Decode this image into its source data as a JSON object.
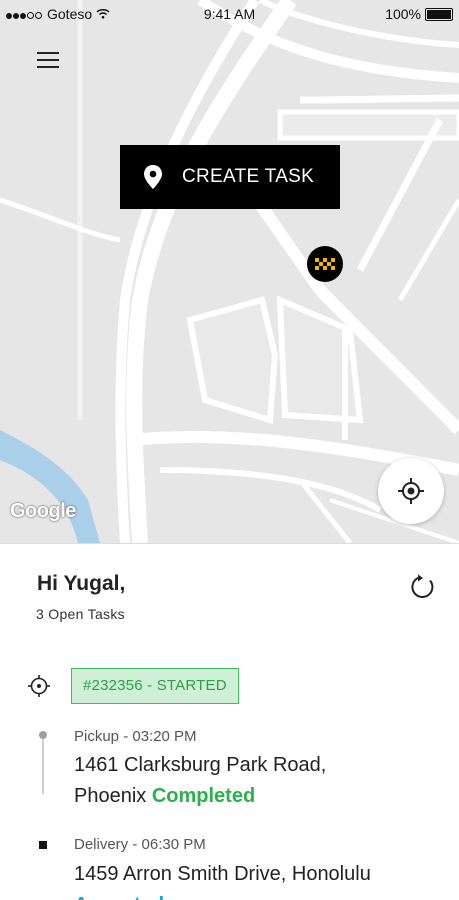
{
  "status_bar": {
    "carrier": "Goteso",
    "time": "9:41 AM",
    "battery": "100%"
  },
  "map": {
    "create_task_label": "CREATE TASK",
    "google_label": "Google"
  },
  "sheet": {
    "greeting": "Hi Yugal,",
    "open_tasks": "3 Open Tasks",
    "task": {
      "badge": "#232356 - STARTED",
      "pickup": {
        "time": "Pickup - 03:20 PM",
        "address_line1": "1461 Clarksburg Park Road,",
        "address_line2": "Phoenix",
        "status": "Completed"
      },
      "delivery": {
        "time": "Delivery - 06:30 PM",
        "address": "1459  Arron Smith Drive, Honolulu",
        "status": "Accepted"
      }
    }
  },
  "colors": {
    "completed": "#2bb14b",
    "accepted": "#1ba3d6",
    "badge_bg": "#cff0d6",
    "badge_text": "#2aa047"
  },
  "icons": [
    "menu-icon",
    "map-pin-icon",
    "taxi-icon",
    "locate-icon",
    "refresh-icon",
    "target-icon",
    "wifi-icon",
    "battery-icon"
  ]
}
